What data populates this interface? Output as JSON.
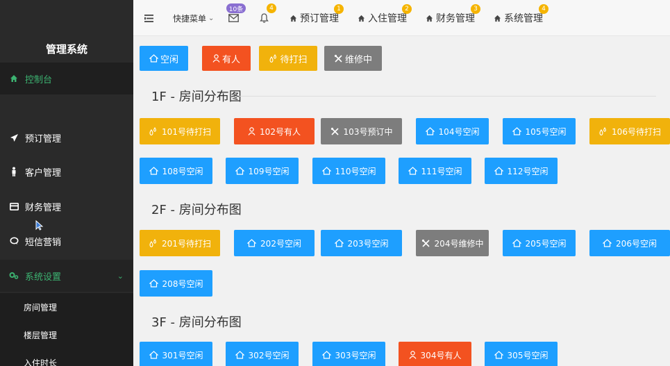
{
  "sidebar": {
    "title": "管理系统",
    "items": [
      {
        "label": "控制台",
        "icon": "home-icon"
      },
      {
        "label": "预订管理",
        "icon": "send-icon"
      },
      {
        "label": "客户管理",
        "icon": "person-icon"
      },
      {
        "label": "财务管理",
        "icon": "card-icon"
      },
      {
        "label": "短信营销",
        "icon": "chat-icon"
      },
      {
        "label": "系统设置",
        "icon": "settings-icon"
      }
    ],
    "sub_items": [
      "房间管理",
      "楼层管理",
      "入住时长"
    ]
  },
  "topbar": {
    "quick_menu": "快捷菜单",
    "mail_badge": "10条",
    "bell_badge": "4",
    "tabs": [
      {
        "label": "预订管理",
        "badge": "1"
      },
      {
        "label": "入住管理",
        "badge": "2"
      },
      {
        "label": "财务管理",
        "badge": "3"
      },
      {
        "label": "系统管理",
        "badge": "4"
      }
    ]
  },
  "legend": [
    "空闲",
    "有人",
    "待打扫",
    "维修中"
  ],
  "colors": {
    "free": "#1e9fff",
    "occupied": "#f35220",
    "dirty": "#f1b20c",
    "repair": "#7d7d7d",
    "sidebar": "#2a2a2a",
    "accent": "#3cb371"
  },
  "floors": [
    {
      "title": "1F - 房间分布图",
      "rows": [
        [
          "101号待打扫",
          "102号有人",
          "103号预订中",
          "104号空闲",
          "105号空闲",
          "106号待打扫"
        ],
        [
          "108号空闲",
          "109号空闲",
          "110号空闲",
          "111号空闲",
          "112号空闲"
        ]
      ]
    },
    {
      "title": "2F - 房间分布图",
      "rows": [
        [
          "201号待打扫",
          "202号空闲",
          "203号空闲",
          "204号维修中",
          "205号空闲",
          "206号空闲"
        ],
        [
          "208号空闲"
        ]
      ]
    },
    {
      "title": "3F - 房间分布图",
      "rows": [
        [
          "301号空闲",
          "302号空闲",
          "303号空闲",
          "304号有人",
          "305号空闲"
        ]
      ]
    }
  ]
}
